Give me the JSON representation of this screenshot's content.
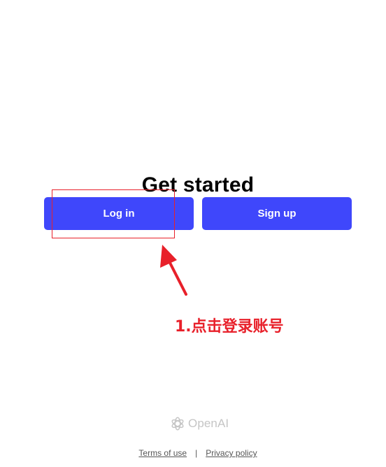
{
  "main": {
    "heading": "Get started",
    "login_label": "Log in",
    "signup_label": "Sign up"
  },
  "annotation": {
    "text": "1.点击登录账号",
    "color": "#e8202a"
  },
  "brand": {
    "name": "OpenAI",
    "icon": "openai-logo-icon"
  },
  "footer": {
    "terms_label": "Terms of use",
    "separator": "|",
    "privacy_label": "Privacy policy"
  },
  "colors": {
    "accent": "#3f47fb",
    "annotation": "#e8202a"
  }
}
